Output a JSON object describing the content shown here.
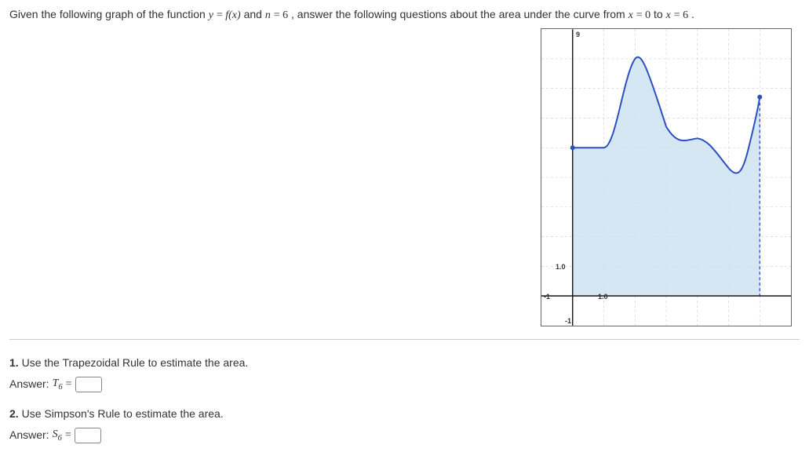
{
  "prompt": {
    "lead": "Given the following graph of the function ",
    "eq1_lhs": "y",
    "eq1_rhs": "f(x)",
    "and": " and ",
    "eq2_lhs": "n",
    "eq2_rhs": "6",
    "tail": ", answer the following questions about the area under the curve from ",
    "eq3_lhs": "x",
    "eq3_rhs": "0",
    "to": " to ",
    "eq4_lhs": "x",
    "eq4_rhs": "6",
    "period": "."
  },
  "graph": {
    "y_top": "9",
    "y_tick": "1.0",
    "x_tick": "1.0",
    "x_left": "-1",
    "y_bottom": "-1"
  },
  "q1": {
    "num": "1.",
    "text": " Use the Trapezoidal Rule to estimate the area.",
    "ans_label": "Answer: ",
    "sym": "T",
    "sub": "6",
    "eq": " = ",
    "value": ""
  },
  "q2": {
    "num": "2.",
    "text": " Use Simpson's Rule to estimate the area.",
    "ans_label": "Answer: ",
    "sym": "S",
    "sub": "6",
    "eq": " = ",
    "value": ""
  },
  "chart_data": {
    "type": "area",
    "title": "",
    "xlabel": "",
    "ylabel": "",
    "xlim": [
      -1,
      7
    ],
    "ylim": [
      -1,
      9
    ],
    "x": [
      0,
      1,
      2,
      3,
      4,
      5,
      6
    ],
    "y": [
      5.0,
      5.0,
      8.0,
      5.7,
      5.3,
      4.3,
      6.7
    ],
    "shaded_from": 0,
    "shaded_to": 6
  }
}
